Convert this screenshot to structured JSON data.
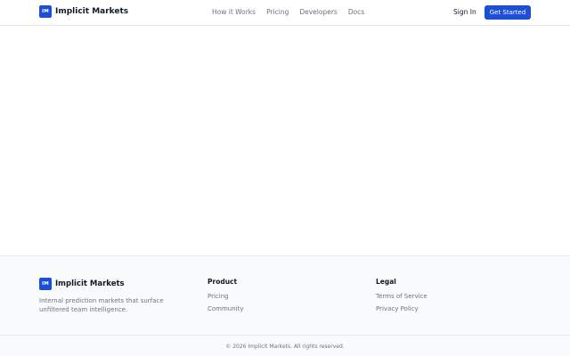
{
  "header": {
    "logo_mark": "IM",
    "brand": "Implicit Markets",
    "nav": [
      "How it Works",
      "Pricing",
      "Developers",
      "Docs"
    ],
    "sign_in": "Sign In",
    "cta": "Get Started"
  },
  "footer": {
    "logo_mark": "IM",
    "brand": "Implicit Markets",
    "tagline": "Internal prediction markets that surface unfiltered team intelligence.",
    "product": {
      "heading": "Product",
      "links": [
        "Pricing",
        "Community"
      ]
    },
    "legal": {
      "heading": "Legal",
      "links": [
        "Terms of Service",
        "Privacy Policy"
      ]
    },
    "copyright": "© 2026 Implicit Markets. All rights reserved."
  },
  "colors": {
    "accent": "#1d4ed8",
    "muted_text": "#6b7280",
    "border": "#e5e7eb",
    "footer_bg": "#f9fafb"
  }
}
